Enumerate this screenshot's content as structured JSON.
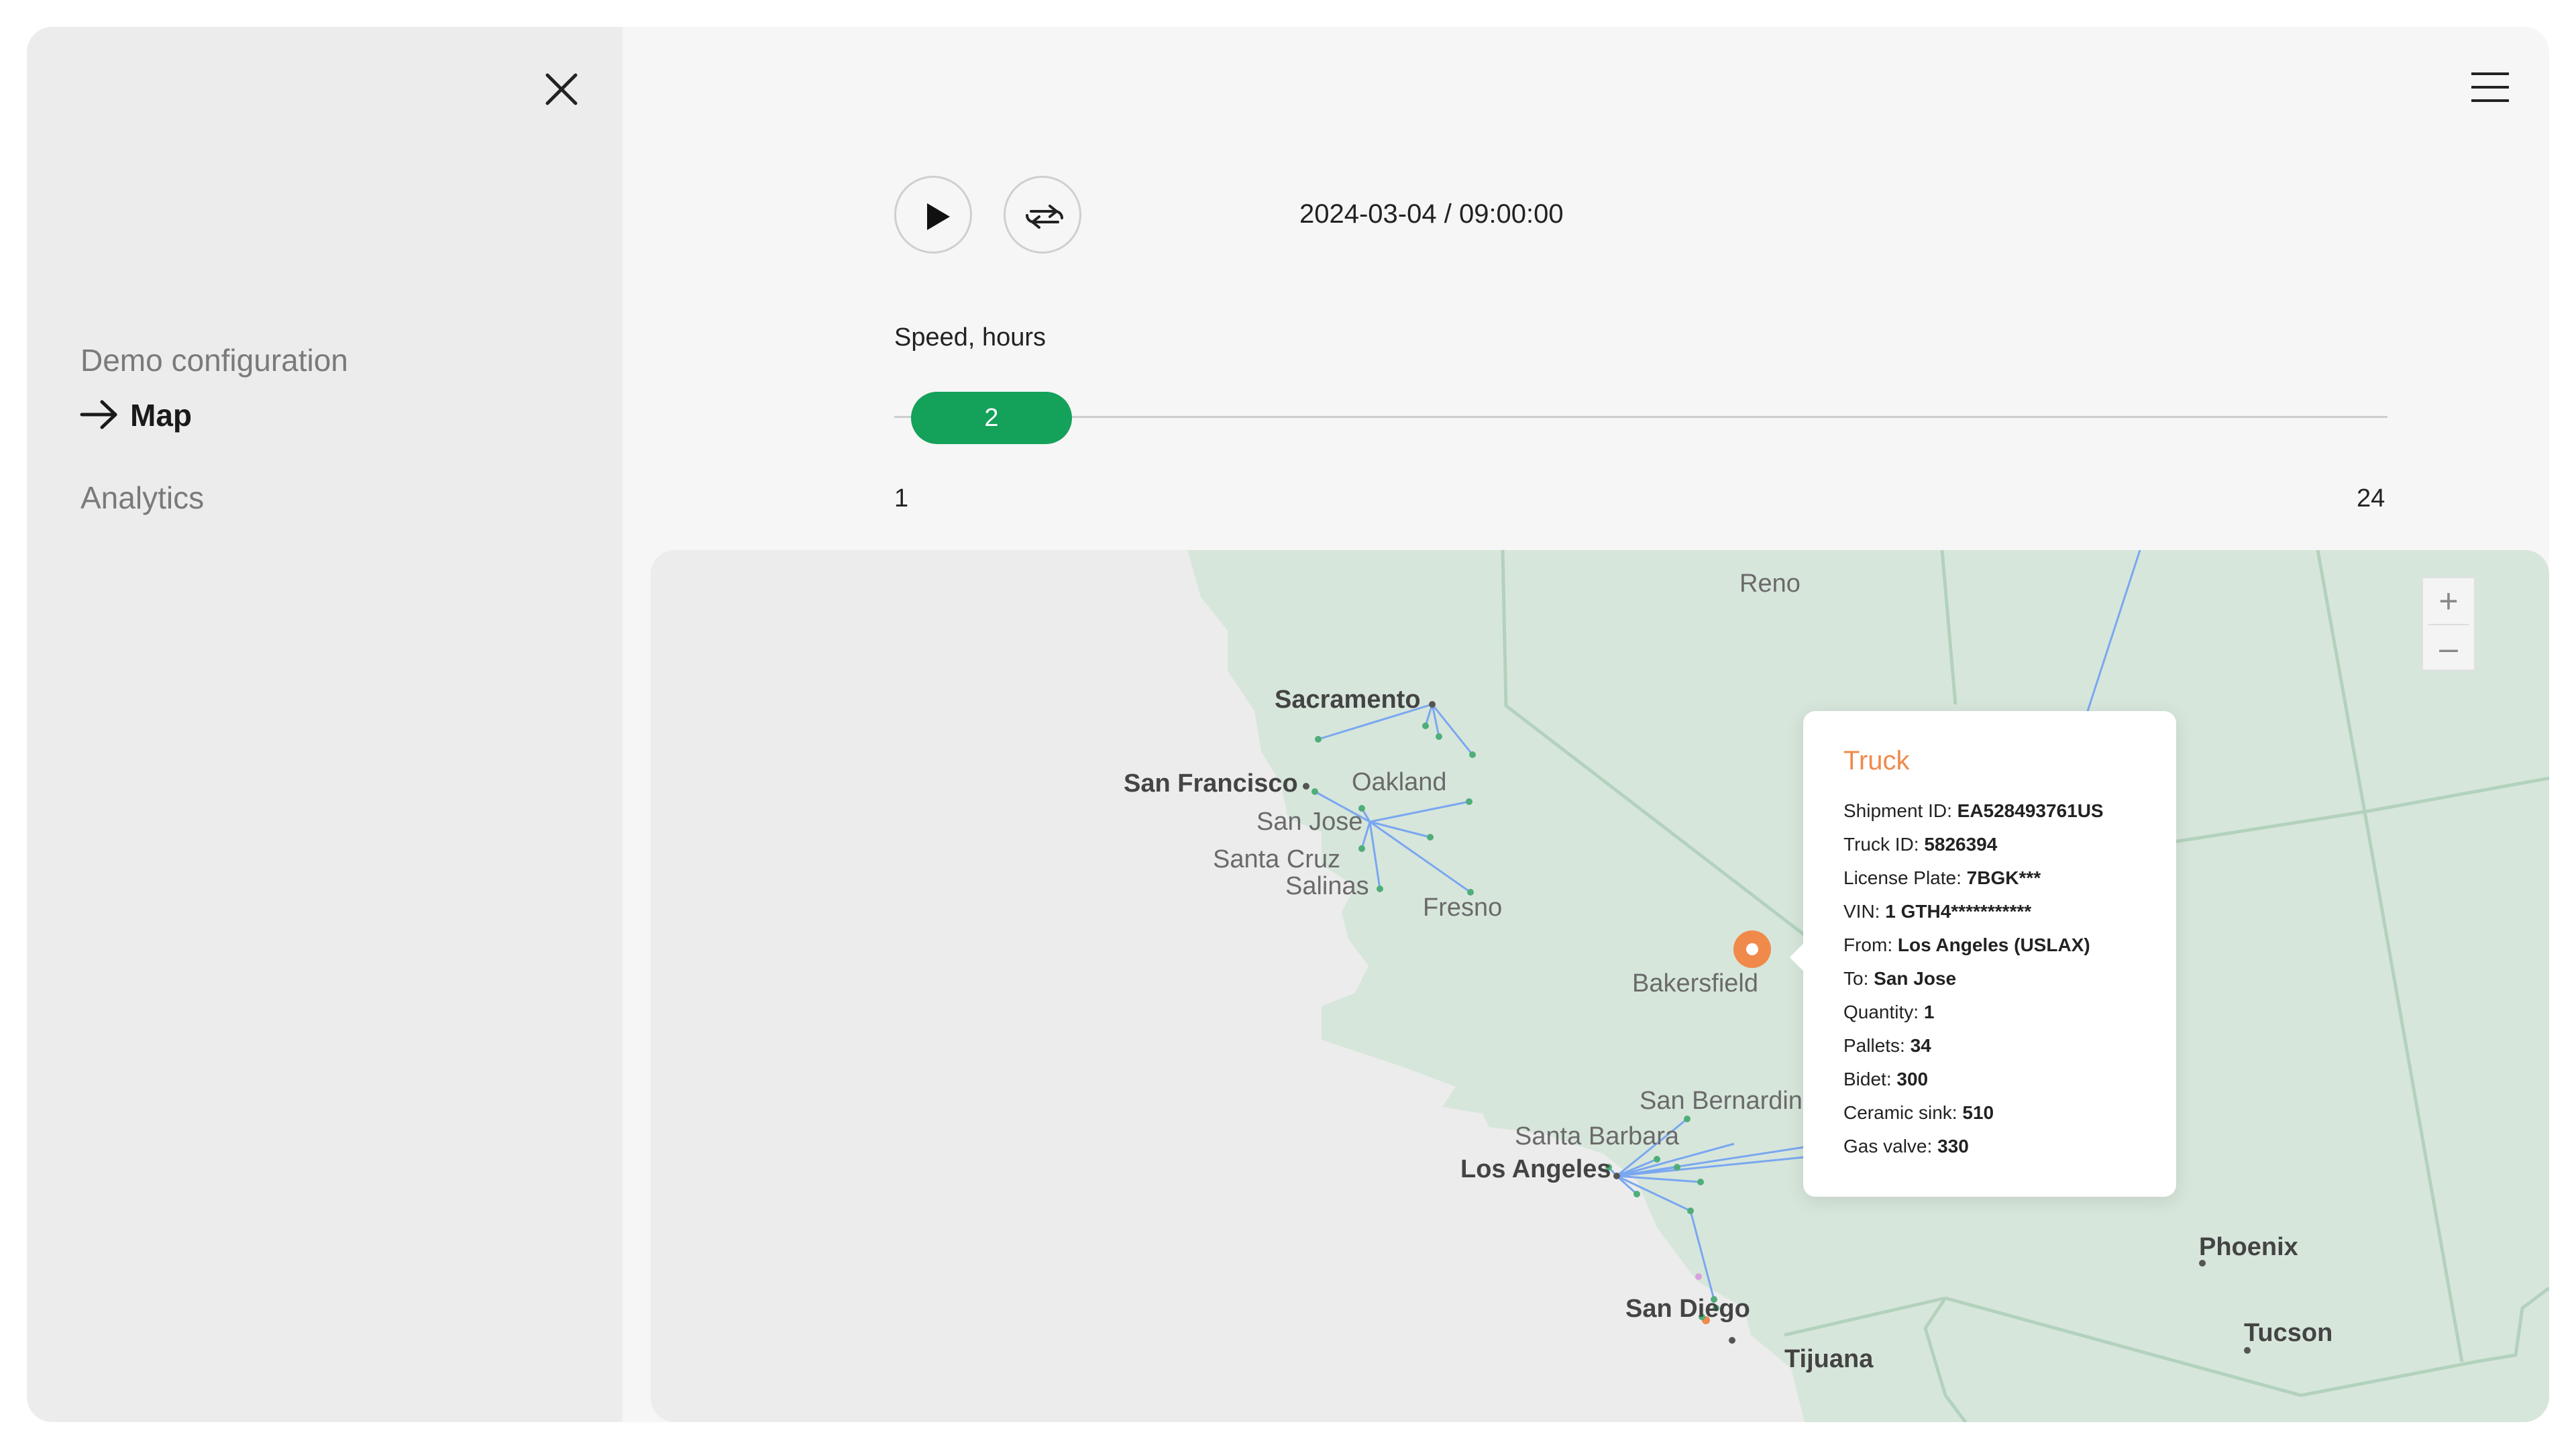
{
  "sidebar": {
    "items": [
      {
        "label": "Demo configuration"
      },
      {
        "label": "Map"
      },
      {
        "label": "Analytics"
      }
    ]
  },
  "playback": {
    "datetime": "2024-03-04 / 09:00:00"
  },
  "speed": {
    "label": "Speed, hours",
    "value": "2",
    "min": "1",
    "max": "24"
  },
  "map": {
    "cities": {
      "reno": "Reno",
      "sacramento": "Sacramento",
      "san_francisco": "San Francisco",
      "oakland": "Oakland",
      "san_jose": "San Jose",
      "santa_cruz": "Santa Cruz",
      "salinas": "Salinas",
      "fresno": "Fresno",
      "bakersfield": "Bakersfield",
      "san_bernardino": "San Bernardin",
      "santa_barbara": "Santa Barbara",
      "los_angeles": "Los Angeles",
      "san_diego": "San Diego",
      "tijuana": "Tijuana",
      "phoenix": "Phoenix",
      "tucson": "Tucson"
    },
    "zoom_in": "+",
    "zoom_out": "–"
  },
  "popup": {
    "title": "Truck",
    "rows": [
      {
        "label": "Shipment ID:",
        "value": "EA528493761US"
      },
      {
        "label": "Truck ID:",
        "value": "5826394"
      },
      {
        "label": "License Plate:",
        "value": "7BGK***"
      },
      {
        "label": "VIN:",
        "value": "1 GTH4***********"
      },
      {
        "label": "From:",
        "value": "Los Angeles (USLAX)"
      },
      {
        "label": "To:",
        "value": "San Jose"
      },
      {
        "label": "Quantity:",
        "value": "1"
      },
      {
        "label": "Pallets:",
        "value": "34"
      },
      {
        "label": "Bidet:",
        "value": "300"
      },
      {
        "label": "Ceramic sink:",
        "value": "510"
      },
      {
        "label": "Gas valve:",
        "value": "330"
      }
    ]
  },
  "colors": {
    "accent_green": "#14a15a",
    "truck_orange": "#f08a4b",
    "route_blue": "#7aa7f0",
    "land_green": "#d7e6db",
    "border_green": "#b3d2bd"
  }
}
